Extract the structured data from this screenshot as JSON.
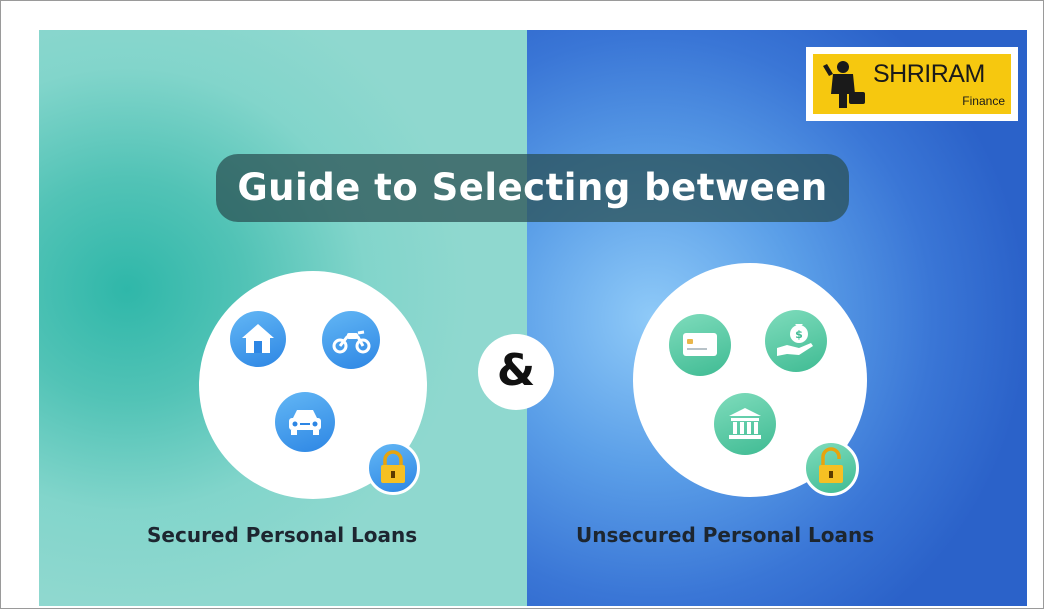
{
  "title": "Guide to Selecting between",
  "conjunction": "&",
  "left": {
    "label": "Secured Personal Loans"
  },
  "right": {
    "label": "Unsecured Personal Loans"
  },
  "logo": {
    "name": "SHRIRAM",
    "sub": "Finance"
  },
  "icons": {
    "left": [
      "home-icon",
      "motorbike-icon",
      "car-icon",
      "locked-padlock-icon"
    ],
    "right": [
      "credit-card-icon",
      "money-bag-hand-icon",
      "bank-icon",
      "unlocked-padlock-icon"
    ]
  },
  "colors": {
    "left_background": "#52c3b6",
    "right_background": "#3a76d6",
    "title_pill": "#284e50",
    "logo_yellow": "#f6c80f",
    "icon_blue": "#2d86e4",
    "icon_teal": "#3fbb93"
  }
}
